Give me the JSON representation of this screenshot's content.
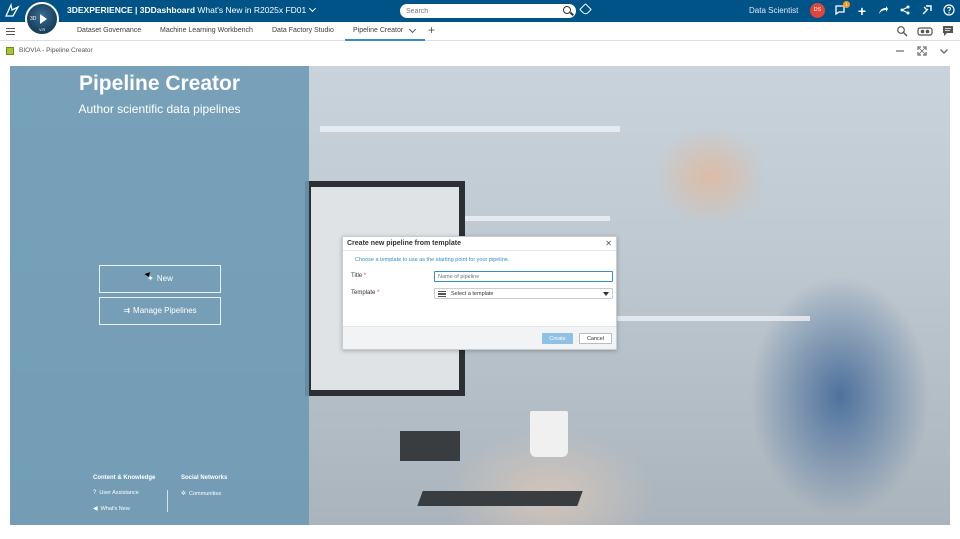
{
  "topbar": {
    "brand_prefix": "3DEXPERIENCE | 3DDashboard",
    "dashboard_name": "What's New in R2025x FD01",
    "search_placeholder": "Search",
    "role": "Data Scientist",
    "avatar_initials": "DS",
    "notification_count": "1",
    "compass_label": "3D",
    "compass_version": "V.R",
    "colors": {
      "bar": "#005386",
      "avatar": "#e2463a",
      "badge": "#f59a23"
    }
  },
  "tabs": [
    {
      "label": "Dataset Governance"
    },
    {
      "label": "Machine Learning Workbench"
    },
    {
      "label": "Data Factory Studio"
    },
    {
      "label": "Pipeline Creator",
      "active": true
    }
  ],
  "widget": {
    "title": "BIOVIA - Pipeline Creator"
  },
  "hero": {
    "title": "Pipeline Creator",
    "subtitle": "Author scientific data pipelines",
    "new_button": "New",
    "manage_button": "Manage Pipelines"
  },
  "footer": {
    "content_title": "Content & Knowledge",
    "user_assistance": "User Assistance",
    "whats_new": "What's New",
    "social_title": "Social Networks",
    "communities": "Communities"
  },
  "dialog": {
    "title": "Create new pipeline from template",
    "hint": "Choose a template to use as the starting point for your pipeline.",
    "title_label": "Title",
    "title_placeholder": "Name of pipeline",
    "template_label": "Template",
    "template_value": "Select a template",
    "required_mark": "*",
    "create_button": "Create",
    "cancel_button": "Cancel"
  }
}
